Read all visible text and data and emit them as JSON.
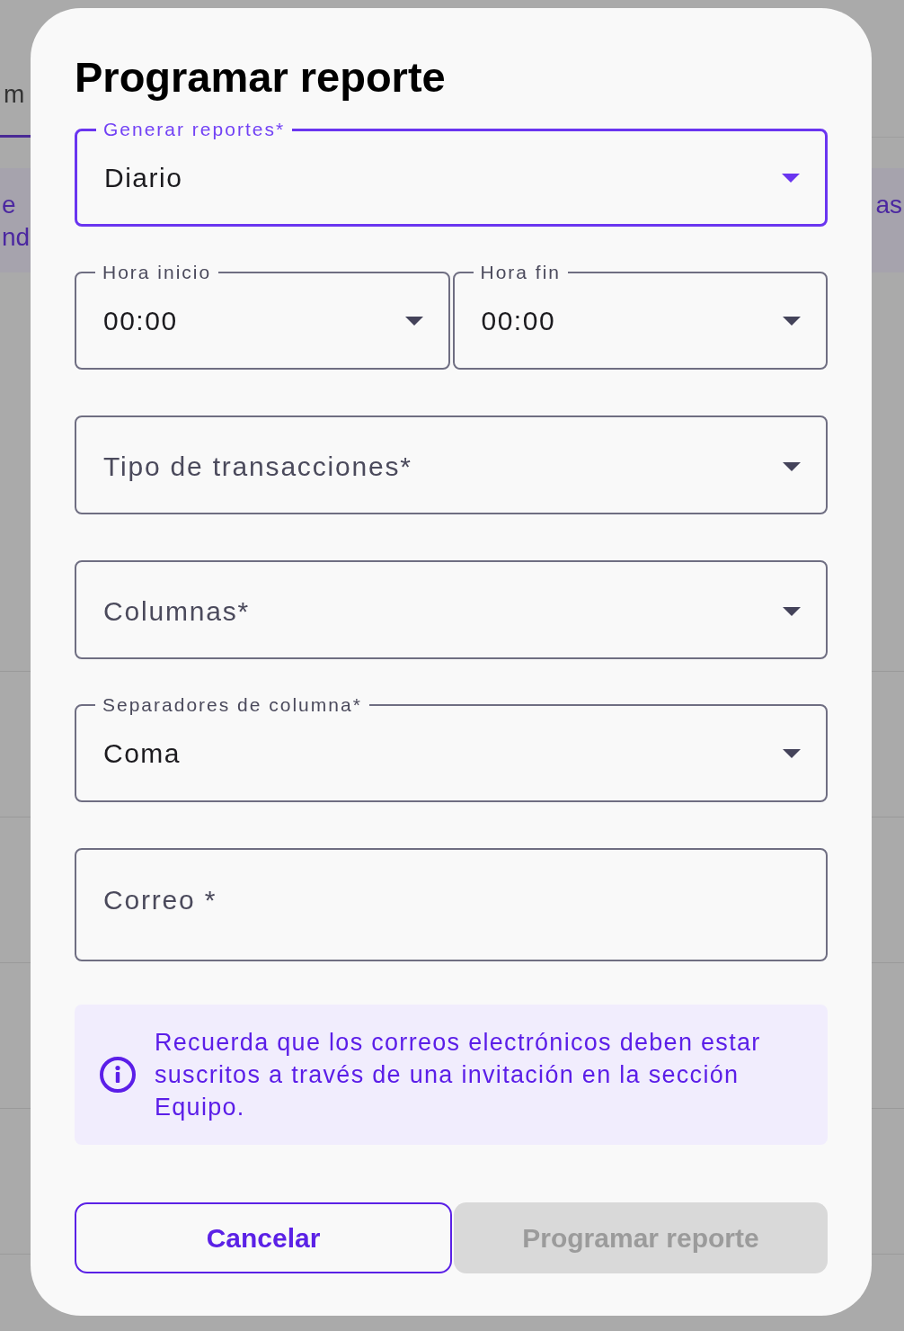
{
  "background": {
    "tab_label": "m",
    "banner_left_lines": [
      "e",
      "nd"
    ],
    "banner_right": "as"
  },
  "dialog": {
    "title": "Programar reporte",
    "rows": [
      {
        "fields": [
          {
            "kind": "select",
            "label": "Generar reportes*",
            "value": "Diario",
            "focused": true
          }
        ]
      },
      {
        "fields": [
          {
            "kind": "select",
            "label": "Hora inicio",
            "value": "00:00",
            "focused": false
          },
          {
            "kind": "select",
            "label": "Hora fin",
            "value": "00:00",
            "focused": false
          }
        ]
      },
      {
        "fields": [
          {
            "kind": "select",
            "label": "Tipo de transacciones*",
            "focused": false
          }
        ]
      },
      {
        "fields": [
          {
            "kind": "select",
            "label": "Columnas*",
            "focused": false
          }
        ]
      },
      {
        "fields": [
          {
            "kind": "select",
            "label": "Separadores de columna*",
            "value": "Coma",
            "focused": false
          }
        ]
      },
      {
        "fields": [
          {
            "kind": "text",
            "label": "Correo *",
            "focused": false
          }
        ]
      }
    ],
    "notice": {
      "text": "Recuerda que los correos electrónicos deben estar suscritos a través de una invitación en la sección Equipo."
    },
    "buttons": [
      {
        "kind": "outlined",
        "label": "Cancelar",
        "disabled": false
      },
      {
        "kind": "filled",
        "label": "Programar reporte",
        "disabled": true
      }
    ]
  }
}
